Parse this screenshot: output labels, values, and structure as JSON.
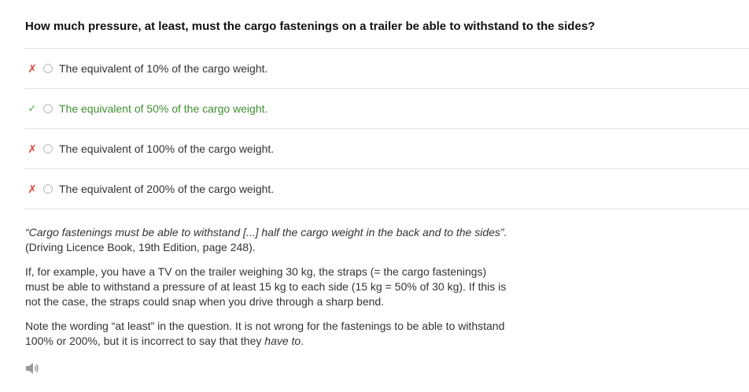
{
  "question": "How much pressure, at least, must the cargo fastenings on a trailer be able to withstand to the sides?",
  "options": [
    {
      "label": "The equivalent of 10% of the cargo weight.",
      "mark": "✗",
      "correct": false
    },
    {
      "label": "The equivalent of 50% of the cargo weight.",
      "mark": "✓",
      "correct": true
    },
    {
      "label": "The equivalent of 100% of the cargo weight.",
      "mark": "✗",
      "correct": false
    },
    {
      "label": "The equivalent of 200% of the cargo weight.",
      "mark": "✗",
      "correct": false
    }
  ],
  "explanation": {
    "quote": "“Cargo fastenings must be able to withstand [...] half the cargo weight in the back and to the sides”.",
    "source": "(Driving Licence Book, 19th Edition, page 248).",
    "para2": "If, for example, you have a TV on the trailer weighing 30 kg, the straps (= the cargo fastenings) must be able to withstand a pressure of at least 15 kg to each side (15 kg = 50% of 30 kg). If this is not the case, the straps could snap when you drive through a sharp bend.",
    "para3_a": "Note the wording “at least” in the question. It is not wrong for the fastenings to be able to withstand 100% or 200%, but it is incorrect to say that they ",
    "para3_em": "have to",
    "para3_b": "."
  },
  "icons": {
    "speaker": "speaker-icon",
    "wrong": "cross-icon",
    "right": "checkmark-icon"
  },
  "colors": {
    "wrong": "#e0463f",
    "right": "#4caf3f",
    "correct_text": "#3f8f2f"
  }
}
